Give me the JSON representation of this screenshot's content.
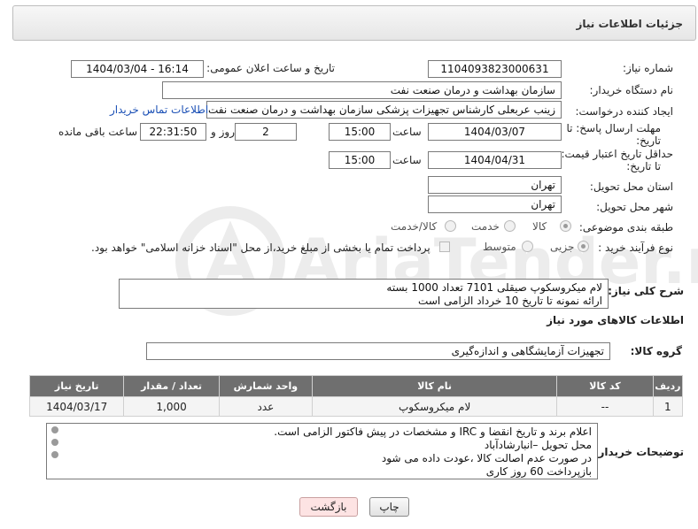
{
  "header": {
    "title": "جزئیات اطلاعات نیاز"
  },
  "fields": {
    "need_number_label": "شماره نیاز:",
    "need_number": "1104093823000631",
    "announce_label": "تاریخ و ساعت اعلان عمومی:",
    "announce_value": "1404/03/04 - 16:14",
    "buyer_org_label": "نام دستگاه خریدار:",
    "buyer_org": "سازمان بهداشت و درمان صنعت نفت",
    "creator_label": "ایجاد کننده درخواست:",
    "creator": "زینب عربعلی کارشناس تجهیزات پزشکی سازمان بهداشت و درمان صنعت نفت",
    "contact_link": "اطلاعات تماس خریدار",
    "deadline_label_1": "مهلت ارسال پاسخ: تا",
    "deadline_label_2": "تاریخ:",
    "deadline_date": "1404/03/07",
    "time_label": "ساعت",
    "deadline_time": "15:00",
    "days_value": "2",
    "days_label": "روز و",
    "remaining_time": "22:31:50",
    "remaining_label": "ساعت باقی مانده",
    "min_validity_label_1": "حداقل تاریخ اعتبار قیمت:",
    "min_validity_label_2": "تا تاریخ:",
    "validity_date": "1404/04/31",
    "validity_time": "15:00",
    "province_label": "استان محل تحویل:",
    "province": "تهران",
    "city_label": "شهر محل تحویل:",
    "city": "تهران",
    "category_label": "طبقه بندی موضوعی:",
    "category_options": [
      "کالا",
      "خدمت",
      "کالا/خدمت"
    ],
    "process_label": "نوع فرآیند خرید :",
    "process_options": [
      "جزیی",
      "متوسط"
    ],
    "payment_note": "پرداخت تمام یا بخشی از مبلغ خرید،از محل \"اسناد خزانه اسلامی\" خواهد بود."
  },
  "description": {
    "label": "شرح کلی نیاز:",
    "line1": "لام میکروسکوپ صیقلی 7101 تعداد 1000 بسته",
    "line2": "ارائه نمونه تا تاریخ 10 خرداد الزامی است"
  },
  "goods": {
    "section_title": "اطلاعات کالاهای مورد نیاز",
    "group_label": "گروه کالا:",
    "group_value": "تجهیزات آزمایشگاهی و اندازه‌گیری",
    "columns": [
      "ردیف",
      "کد کالا",
      "نام کالا",
      "واحد شمارش",
      "تعداد / مقدار",
      "تاریخ نیاز"
    ],
    "rows": [
      {
        "row": "1",
        "code": "--",
        "name": "لام میکروسکوپ",
        "unit": "عدد",
        "qty": "1,000",
        "date": "1404/03/17"
      }
    ]
  },
  "buyer_notes": {
    "label": "توضیحات خریدار:",
    "lines": [
      "اعلام برند و تاریخ انقضا  و IRC  و مشخصات  در پیش فاکتور الزامی است.",
      "محل تحویل –انبارشادآباد",
      "در صورت عدم اصالت کالا ،عودت داده می شود",
      "بازپرداخت 60 روز کاری"
    ]
  },
  "buttons": {
    "print": "چاپ",
    "back": "بازگشت"
  },
  "watermark": {
    "text": "AriaTender.neT",
    "color": "#e8e8e8"
  }
}
